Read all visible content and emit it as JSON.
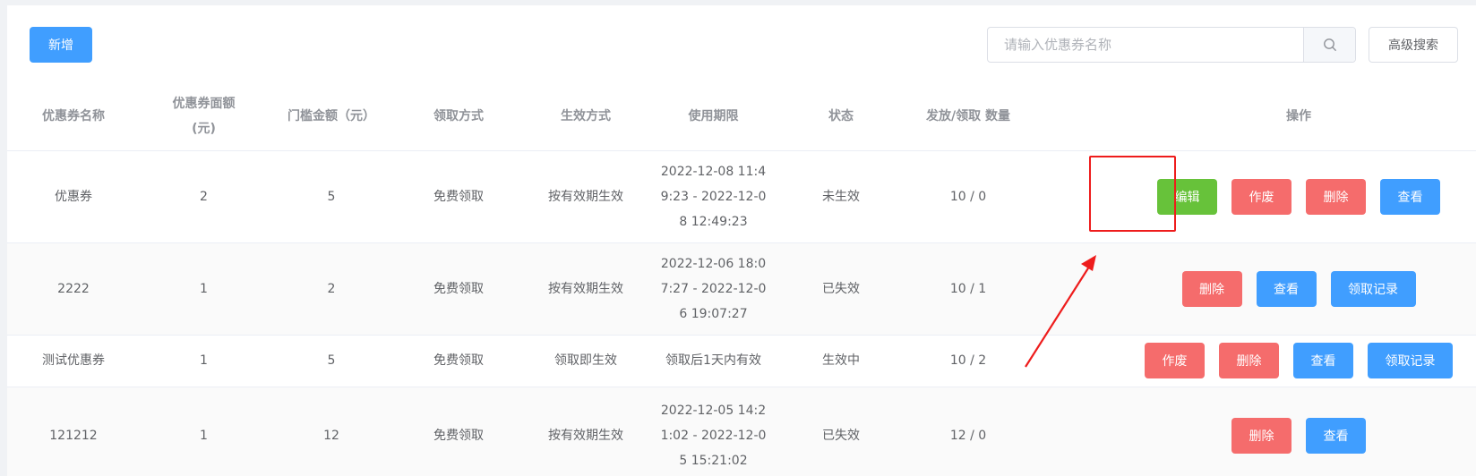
{
  "toolbar": {
    "add_label": "新增",
    "search_placeholder": "请输入优惠券名称",
    "search_value": "",
    "advanced_search_label": "高级搜索"
  },
  "table": {
    "headers": {
      "name": "优惠券名称",
      "face_value_line1": "优惠券面额",
      "face_value_line2": "(元)",
      "threshold": "门槛金额（元）",
      "receive_method": "领取方式",
      "effective_method": "生效方式",
      "validity": "使用期限",
      "status": "状态",
      "quantity": "发放/领取 数量",
      "actions": "操作"
    },
    "rows": [
      {
        "name": "优惠券",
        "face_value": "2",
        "threshold": "5",
        "receive_method": "免费领取",
        "effective_method": "按有效期生效",
        "validity_l1": "2022-12-08 11:4",
        "validity_l2": "9:23 - 2022-12-0",
        "validity_l3": "8 12:49:23",
        "status": "未生效",
        "quantity": "10 / 0",
        "actions": {
          "edit": "编辑",
          "void": "作废",
          "delete": "删除",
          "view": "查看"
        }
      },
      {
        "name": "2222",
        "face_value": "1",
        "threshold": "2",
        "receive_method": "免费领取",
        "effective_method": "按有效期生效",
        "validity_l1": "2022-12-06 18:0",
        "validity_l2": "7:27 - 2022-12-0",
        "validity_l3": "6 19:07:27",
        "status": "已失效",
        "quantity": "10 / 1",
        "actions": {
          "delete": "删除",
          "view": "查看",
          "records": "领取记录"
        }
      },
      {
        "name": "测试优惠券",
        "face_value": "1",
        "threshold": "5",
        "receive_method": "免费领取",
        "effective_method": "领取即生效",
        "validity": "领取后1天内有效",
        "status": "生效中",
        "quantity": "10 / 2",
        "actions": {
          "void": "作废",
          "delete": "删除",
          "view": "查看",
          "records": "领取记录"
        }
      },
      {
        "name": "121212",
        "face_value": "1",
        "threshold": "12",
        "receive_method": "免费领取",
        "effective_method": "按有效期生效",
        "validity_l1": "2022-12-05 14:2",
        "validity_l2": "1:02 - 2022-12-0",
        "validity_l3": "5 15:21:02",
        "status": "已失效",
        "quantity": "12 / 0",
        "actions": {
          "delete": "删除",
          "view": "查看"
        }
      }
    ]
  },
  "colors": {
    "primary": "#409eff",
    "danger": "#f56c6c",
    "success": "#67c23a",
    "annotation": "#ee1c1c"
  },
  "icons": {
    "search": "search-icon"
  }
}
